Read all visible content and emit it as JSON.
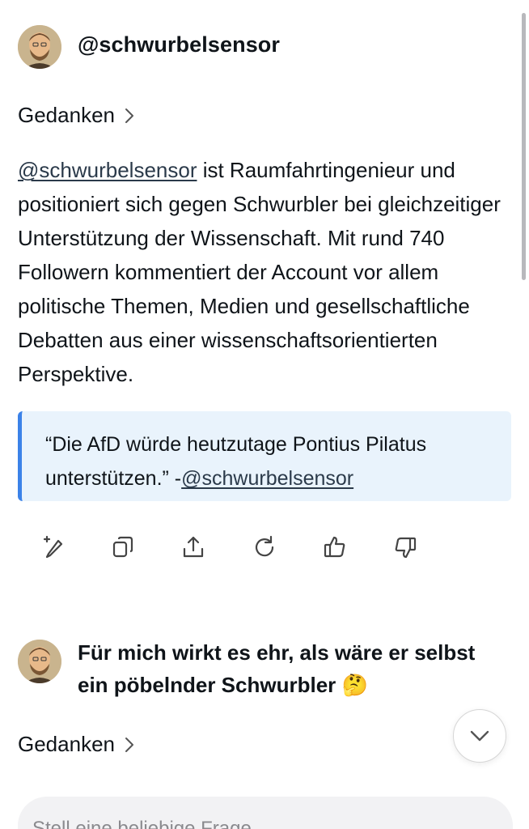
{
  "header": {
    "username": "@schwurbelsensor"
  },
  "thoughts": {
    "label": "Gedanken"
  },
  "bio": {
    "mention": "@schwurbelsensor",
    "text": " ist Raumfahrtingenieur und positioniert sich gegen Schwurbler bei gleichzeitiger Unterstützung der Wissenschaft. Mit rund 740 Followern kommentiert der Account vor allem politische Themen, Medien und gesellschaftliche Debatten aus einer wissenschaftsorientierten Perspektive."
  },
  "quote": {
    "text": "“Die AfD würde heutzutage Pontius Pilatus unterstützen.” -",
    "mention": "@schwurbelsensor"
  },
  "actions": [
    "edit-icon",
    "copy-icon",
    "share-icon",
    "regenerate-icon",
    "thumbs-up-icon",
    "thumbs-down-icon"
  ],
  "reply": {
    "text": "Für mich wirkt es ehr, als wäre er selbst ein pöbelnder Schwurbler 🤔"
  },
  "thoughts2": {
    "label": "Gedanken"
  },
  "input": {
    "placeholder": "Stell eine beliebige Frage"
  },
  "colors": {
    "accent": "#3b82e8",
    "quote_bg": "#e9f3fc"
  }
}
